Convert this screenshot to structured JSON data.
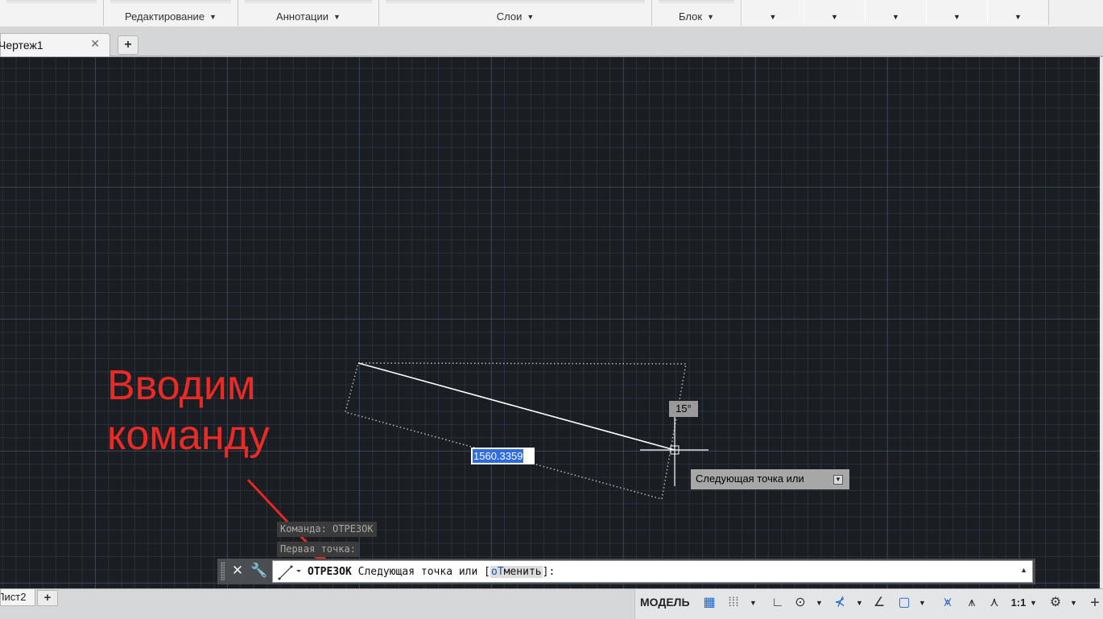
{
  "ribbon": {
    "panels": [
      {
        "label": "Редактирование"
      },
      {
        "label": "Аннотации"
      },
      {
        "label": "Слои"
      },
      {
        "label": "Блок"
      }
    ],
    "dropdown_arrow": "▼"
  },
  "tabs": {
    "document": "Чертеж1",
    "close": "✕",
    "add": "+"
  },
  "canvas": {
    "angle_tooltip": "15°",
    "distance_value": "1560.3359",
    "next_point_tooltip": "Следующая точка или",
    "annotation": "Вводим команду",
    "history": [
      "Команда: ОТРЕЗОК",
      "Первая точка:"
    ]
  },
  "command_line": {
    "command": "ОТРЕЗОК",
    "prompt": "Следующая точка или [",
    "option_key": "оТ",
    "option_rest": "менить",
    "prompt_end": "]:",
    "close_icon": "close-icon",
    "customize_icon": "wrench-icon"
  },
  "status_bar": {
    "layout_tab": "Лист2",
    "add": "+",
    "model": "МОДЕЛЬ",
    "scale": "1:1"
  }
}
